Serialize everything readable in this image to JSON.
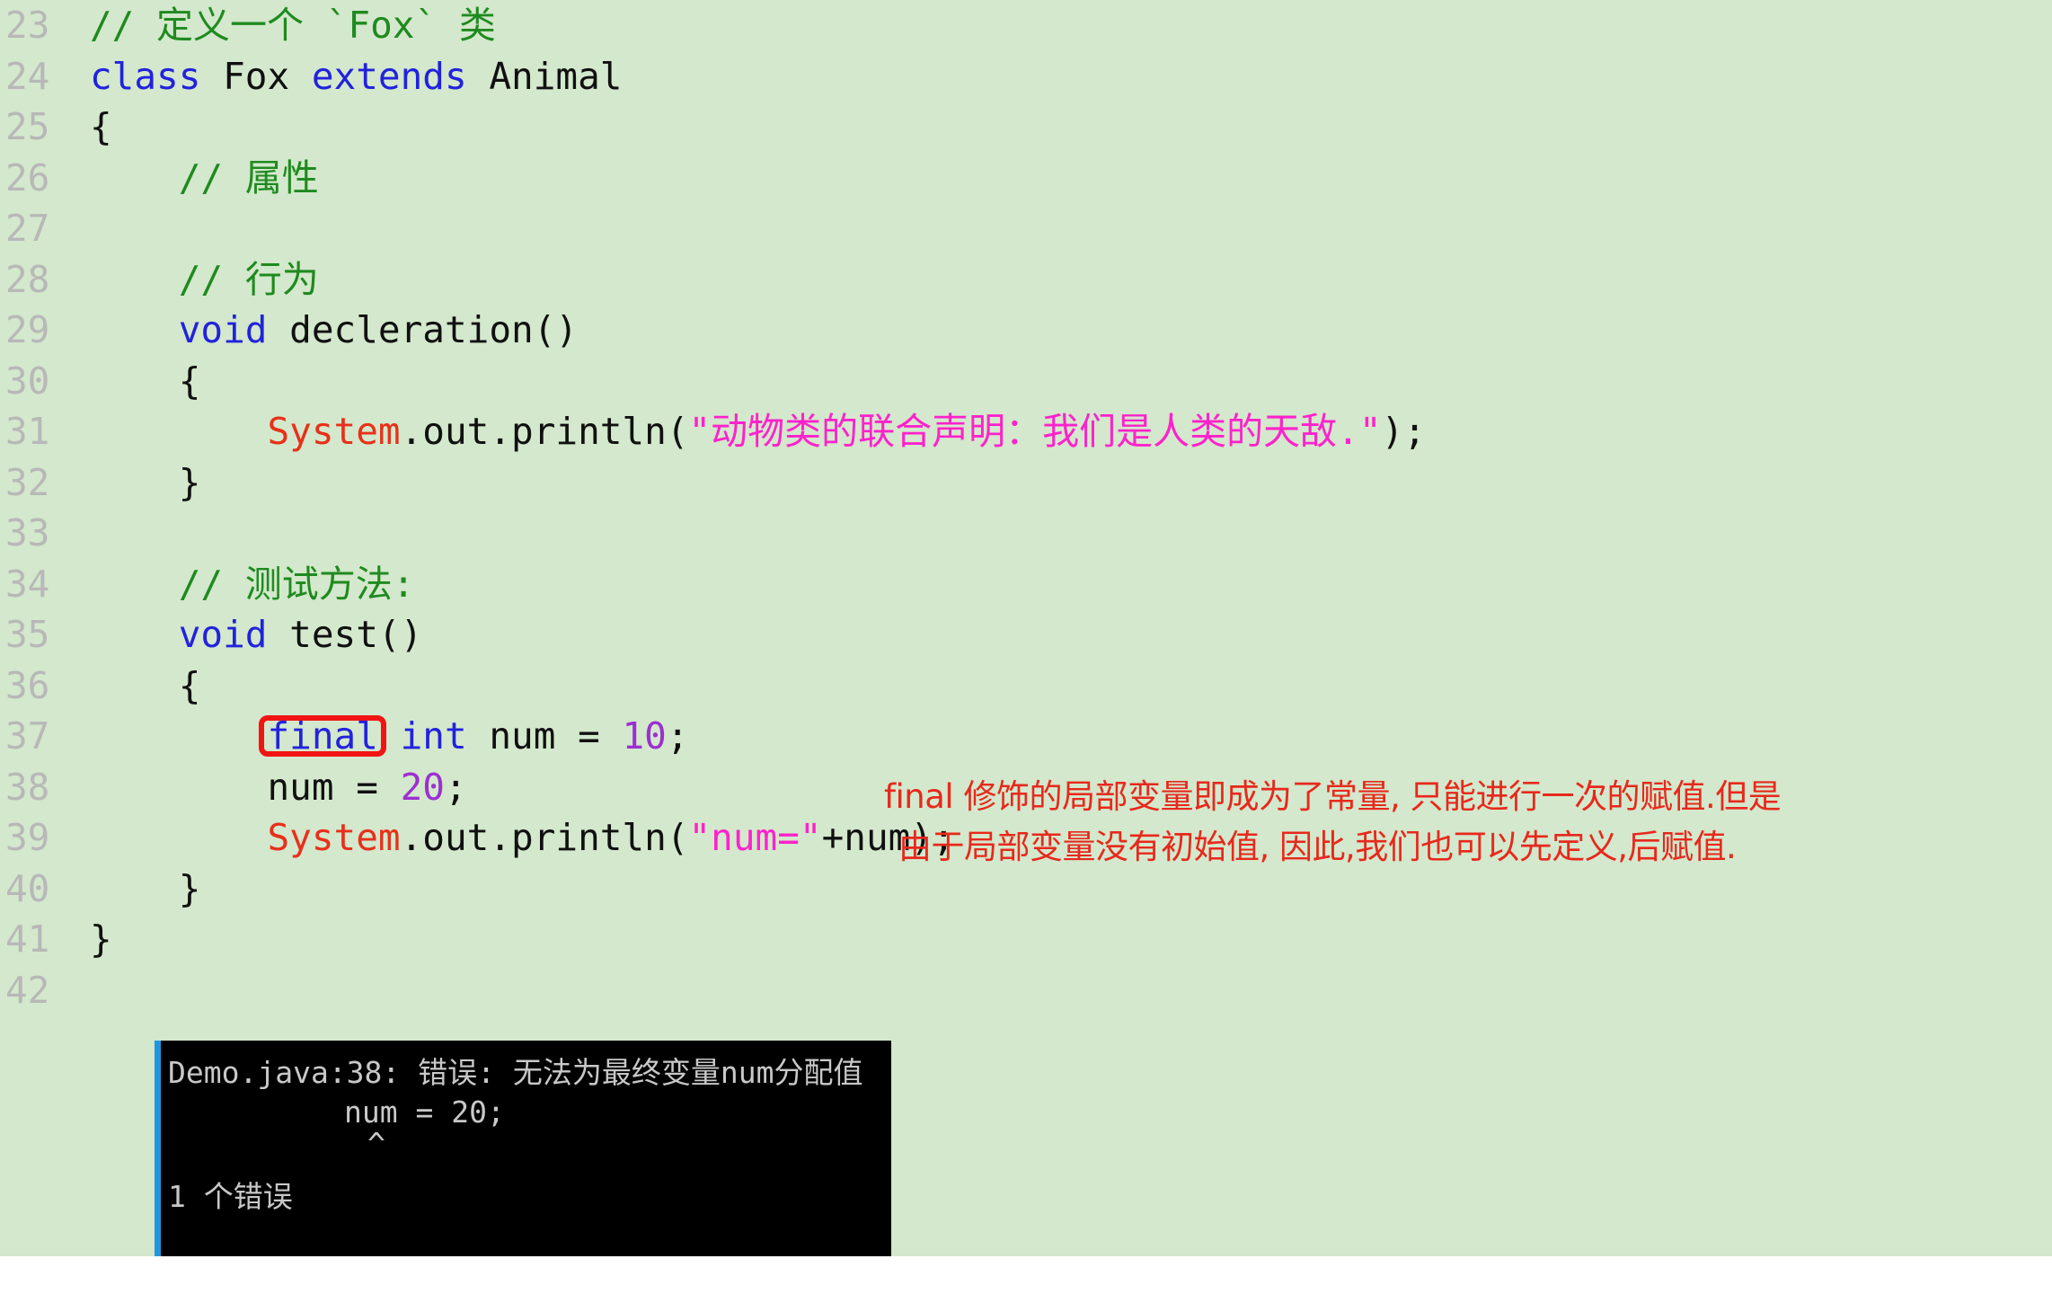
{
  "editor": {
    "background_color": "#d3e8cc",
    "gutter_color": "#b8b8b8",
    "language": "java",
    "first_line_number": 23,
    "lines": [
      {
        "number": "23",
        "indent": 0,
        "tokens": [
          {
            "t": "// 定义一个 `Fox` 类",
            "c": "tok-comment"
          }
        ]
      },
      {
        "number": "24",
        "indent": 0,
        "tokens": [
          {
            "t": "class ",
            "c": "tok-keyword"
          },
          {
            "t": "Fox ",
            "c": "tok-plain"
          },
          {
            "t": "extends ",
            "c": "tok-keyword"
          },
          {
            "t": "Animal",
            "c": "tok-plain"
          }
        ]
      },
      {
        "number": "25",
        "indent": 0,
        "tokens": [
          {
            "t": "{",
            "c": "tok-plain"
          }
        ]
      },
      {
        "number": "26",
        "indent": 1,
        "tokens": [
          {
            "t": "// 属性",
            "c": "tok-comment"
          }
        ]
      },
      {
        "number": "27",
        "indent": 0,
        "tokens": []
      },
      {
        "number": "28",
        "indent": 1,
        "tokens": [
          {
            "t": "// 行为",
            "c": "tok-comment"
          }
        ]
      },
      {
        "number": "29",
        "indent": 1,
        "tokens": [
          {
            "t": "void ",
            "c": "tok-keyword"
          },
          {
            "t": "decleration()",
            "c": "tok-plain"
          }
        ]
      },
      {
        "number": "30",
        "indent": 1,
        "tokens": [
          {
            "t": "{",
            "c": "tok-plain"
          }
        ]
      },
      {
        "number": "31",
        "indent": 2,
        "tokens": [
          {
            "t": "System",
            "c": "tok-class"
          },
          {
            "t": ".out.println(",
            "c": "tok-plain"
          },
          {
            "t": "\"动物类的联合声明：我们是人类的天敌.\"",
            "c": "tok-string"
          },
          {
            "t": ");",
            "c": "tok-plain"
          }
        ]
      },
      {
        "number": "32",
        "indent": 1,
        "tokens": [
          {
            "t": "}",
            "c": "tok-plain"
          }
        ]
      },
      {
        "number": "33",
        "indent": 0,
        "tokens": []
      },
      {
        "number": "34",
        "indent": 1,
        "tokens": [
          {
            "t": "// 测试方法:",
            "c": "tok-comment"
          }
        ]
      },
      {
        "number": "35",
        "indent": 1,
        "tokens": [
          {
            "t": "void ",
            "c": "tok-keyword"
          },
          {
            "t": "test()",
            "c": "tok-plain"
          }
        ]
      },
      {
        "number": "36",
        "indent": 1,
        "tokens": [
          {
            "t": "{",
            "c": "tok-plain"
          }
        ]
      },
      {
        "number": "37",
        "indent": 2,
        "highlight": "final",
        "tokens": [
          {
            "t": "final",
            "c": "final-box"
          },
          {
            "t": " ",
            "c": "tok-plain"
          },
          {
            "t": "int ",
            "c": "tok-keyword"
          },
          {
            "t": "num = ",
            "c": "tok-plain"
          },
          {
            "t": "10",
            "c": "tok-number"
          },
          {
            "t": ";",
            "c": "tok-plain"
          }
        ]
      },
      {
        "number": "38",
        "indent": 2,
        "tokens": [
          {
            "t": "num = ",
            "c": "tok-plain"
          },
          {
            "t": "20",
            "c": "tok-number"
          },
          {
            "t": ";",
            "c": "tok-plain"
          }
        ]
      },
      {
        "number": "39",
        "indent": 2,
        "tokens": [
          {
            "t": "System",
            "c": "tok-class"
          },
          {
            "t": ".out.println(",
            "c": "tok-plain"
          },
          {
            "t": "\"num=\"",
            "c": "tok-string"
          },
          {
            "t": "+num);",
            "c": "tok-plain"
          }
        ]
      },
      {
        "number": "40",
        "indent": 1,
        "tokens": [
          {
            "t": "}",
            "c": "tok-plain"
          }
        ]
      },
      {
        "number": "41",
        "indent": 0,
        "tokens": [
          {
            "t": "}",
            "c": "tok-plain"
          }
        ]
      },
      {
        "number": "42",
        "indent": 0,
        "tokens": []
      }
    ]
  },
  "annotation": {
    "color": "#e8281c",
    "line1": "final 修饰的局部变量即成为了常量, 只能进行一次的赋值.但是",
    "line2": "由于局部变量没有初始值, 因此,我们也可以先定义,后赋值."
  },
  "highlight_box": {
    "target_text": "final",
    "border_color": "#f21414",
    "shape": "rounded-rectangle"
  },
  "console": {
    "background_color": "#000000",
    "text_color": "#c8c8c8",
    "accent_border_color": "#2196e0",
    "lines": [
      "Demo.java:38: 错误: 无法为最终变量num分配值",
      "num = 20;",
      "^",
      "",
      "1 个错误"
    ],
    "error_header": "Demo.java:38: 错误: 无法为最终变量num分配值",
    "error_source": "num = 20;",
    "error_caret": "^",
    "error_count": "1 个错误"
  }
}
